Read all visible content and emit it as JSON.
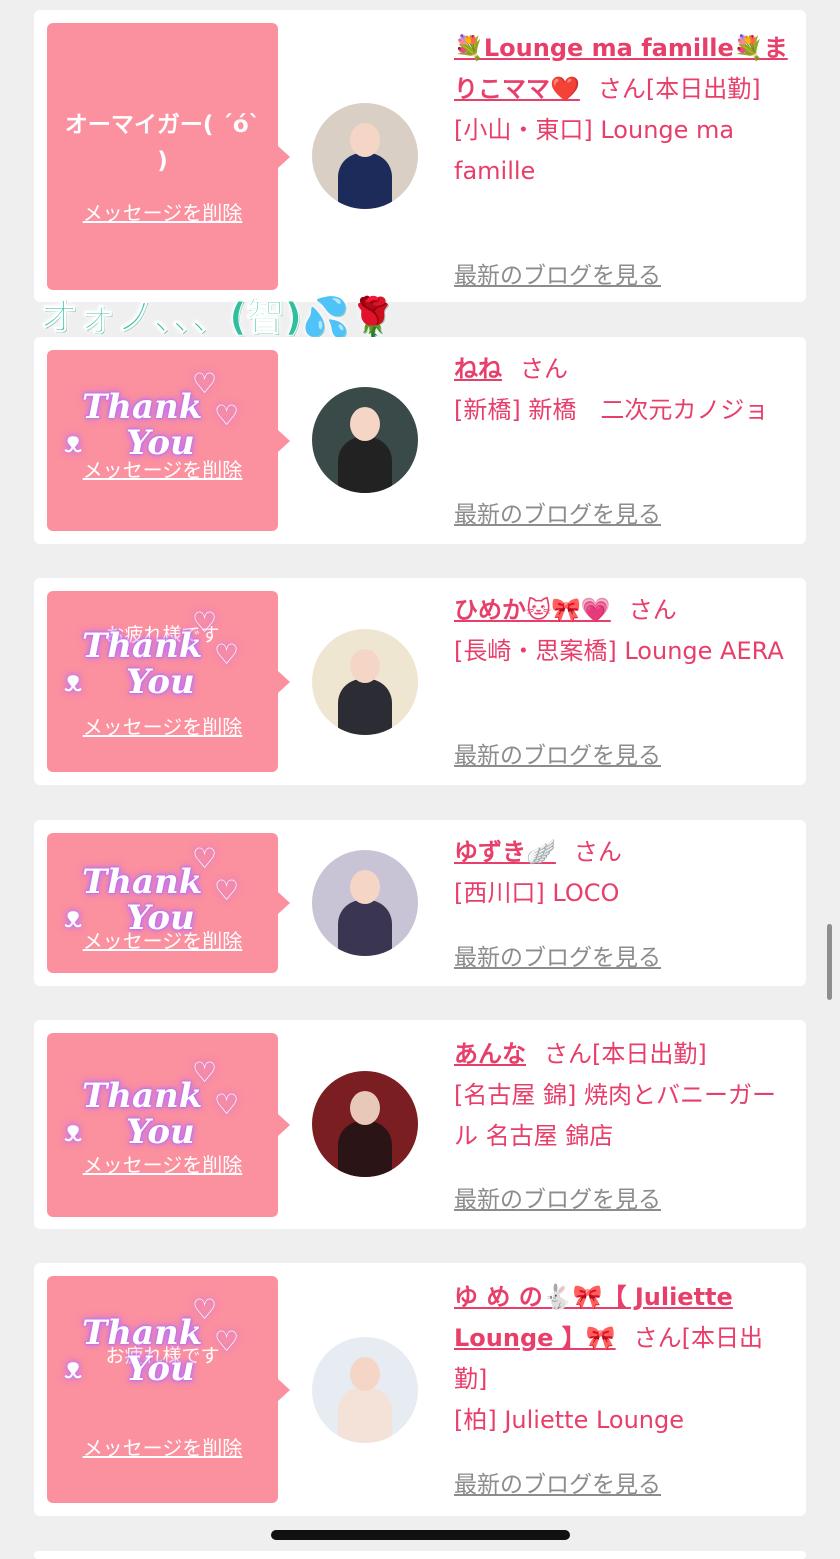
{
  "cards": [
    {
      "bubble_text": "オーマイガー( ´ó` )",
      "delete_label": "メッセージを削除",
      "has_sticker": false,
      "name_label": "💐Lounge ma famille💐まりこママ❤️",
      "san_label": "さん",
      "status": "[本日出勤]",
      "shop": "[小山・東口] Lounge ma famille",
      "blog_label": "最新のブログを見る"
    },
    {
      "bubble_text": "",
      "delete_label": "メッセージを削除",
      "has_sticker": true,
      "name_label": "ねね",
      "san_label": "さん",
      "status": "",
      "shop": "[新橋] 新橋　二次元カノジョ",
      "blog_label": "最新のブログを見る"
    },
    {
      "bubble_text": "お疲れ様です",
      "delete_label": "メッセージを削除",
      "has_sticker": true,
      "name_label": "ひめか🐱🎀💗",
      "san_label": "さん",
      "status": "",
      "shop": "[長崎・思案橋] Lounge AERA",
      "blog_label": "最新のブログを見る"
    },
    {
      "bubble_text": "",
      "delete_label": "メッセージを削除",
      "has_sticker": true,
      "name_label": "ゆずき🪽",
      "san_label": "さん",
      "status": "",
      "shop": "[西川口] LOCO",
      "blog_label": "最新のブログを見る"
    },
    {
      "bubble_text": "",
      "delete_label": "メッセージを削除",
      "has_sticker": true,
      "name_label": "あんな",
      "san_label": "さん",
      "status": "[本日出勤]",
      "shop": "[名古屋 錦] 焼肉とバニーガール 名古屋 錦店",
      "blog_label": "最新のブログを見る"
    },
    {
      "bubble_text": "お疲れ様です",
      "delete_label": "メッセージを削除",
      "has_sticker": true,
      "name_label": "ゆ め の🐇🎀【 Juliette Lounge 】🎀",
      "san_label": "さん",
      "status": "[本日出勤]",
      "shop": "[柏] Juliette Lounge",
      "blog_label": "最新のブログを見る"
    }
  ],
  "overlay_text": "オォノ、、、(智)💦🌹",
  "sticker": {
    "line1": "Thank",
    "line2": "You"
  },
  "colors": {
    "bubble": "#fb909f",
    "name": "#e83e6a",
    "link_gray": "#8c8c8c",
    "overlay": "#2fbf9f"
  }
}
